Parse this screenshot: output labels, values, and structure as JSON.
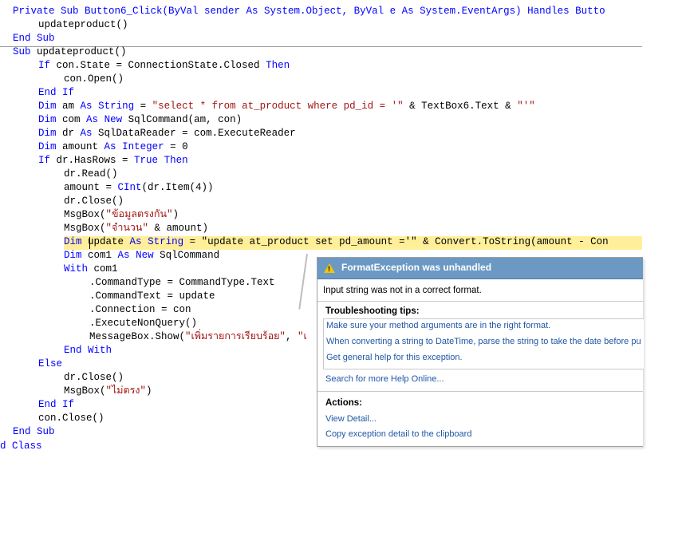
{
  "code": {
    "header_line": {
      "t1": "Private Sub Button6_Click(ByVal sender As System.Object, ByVal e As System.EventArgs) ",
      "t2": "Handles Butto"
    },
    "call_update": "updateproduct()",
    "end_sub_1": "End Sub",
    "sub_decl": {
      "kw": "Sub",
      "rest": " updateproduct()"
    },
    "if_state": {
      "kw1": "If",
      "mid": " con.State = ConnectionState.Closed ",
      "kw2": "Then"
    },
    "con_open": "con.Open()",
    "end_if_1": "End If",
    "dim_am": {
      "kw1": "Dim",
      "a": " am ",
      "kw2": "As",
      "b": " ",
      "kw3": "String",
      "c": " = ",
      "s1": "\"select * from at_product where pd_id = '\"",
      "d": " & TextBox6.Text & ",
      "s2": "\"'\""
    },
    "dim_com": {
      "kw1": "Dim",
      "a": " com ",
      "kw2": "As",
      "b": " ",
      "kw3": "New",
      "c": " SqlCommand(am, con)"
    },
    "dim_dr": {
      "kw1": "Dim",
      "a": " dr ",
      "kw2": "As",
      "b": " SqlDataReader = com.ExecuteReader"
    },
    "dim_amount": {
      "kw1": "Dim",
      "a": " amount ",
      "kw2": "As",
      "b": " ",
      "kw3": "Integer",
      "c": " = 0"
    },
    "if_hasrows": {
      "kw1": "If",
      "a": " dr.HasRows = ",
      "kw2": "True",
      "b": " ",
      "kw3": "Then"
    },
    "dr_read": "dr.Read()",
    "amount_assign": {
      "a": "amount = ",
      "kw1": "CInt",
      "b": "(dr.Item(4))"
    },
    "dr_close_1": "dr.Close()",
    "msg1": {
      "a": "MsgBox(",
      "s": "\"ข้อมูลตรงกัน\"",
      "b": ")"
    },
    "msg2": {
      "a": "MsgBox(",
      "s": "\"จำนวน\"",
      "b": " & amount)"
    },
    "dim_update": {
      "kw1": "Dim",
      "a": " update ",
      "kw2": "As",
      "b": " ",
      "kw3": "String",
      "c": " = \"update at_product set pd_amount ='\" & Convert.ToString(amount - Con"
    },
    "dim_com1": {
      "kw1": "Dim",
      "a": " com1 ",
      "kw2": "As",
      "b": " ",
      "kw3": "New",
      "c": " SqlCommand"
    },
    "with_com1": {
      "kw1": "With",
      "a": " com1"
    },
    "cmd_type": ".CommandType = CommandType.Text",
    "cmd_text": ".CommandText = update",
    "connection": ".Connection = con",
    "exec_nonquery": ".ExecuteNonQuery()",
    "msgbox_show": {
      "a": "MessageBox.Show(",
      "s": "\"เพิ่มรายการเรียบร้อย\"",
      "b": ", ",
      "s2": "\"เ"
    },
    "end_with": "End With",
    "else": "Else",
    "dr_close_2": "dr.Close()",
    "msg3": {
      "a": "MsgBox(",
      "s": "\"ไม่ตรง\"",
      "b": ")"
    },
    "end_if_2": "End If",
    "con_close": "con.Close()",
    "end_sub_2": "End Sub",
    "end_class": "d Class"
  },
  "dialog": {
    "title": "FormatException was unhandled",
    "message": "Input string was not in a correct format.",
    "tips_heading": "Troubleshooting tips:",
    "tips": [
      "Make sure your method arguments are in the right format.",
      "When converting a string to DateTime, parse the string to take the date before pu",
      "Get general help for this exception."
    ],
    "search_link": "Search for more Help Online...",
    "actions_heading": "Actions:",
    "actions": [
      "View Detail...",
      "Copy exception detail to the clipboard"
    ],
    "warn_glyph": "!"
  },
  "colors": {
    "keyword": "#0000ff",
    "string": "#a31515",
    "highlight": "#ffef99",
    "dialog_title": "#6b99c4",
    "link": "#1f57a4"
  }
}
